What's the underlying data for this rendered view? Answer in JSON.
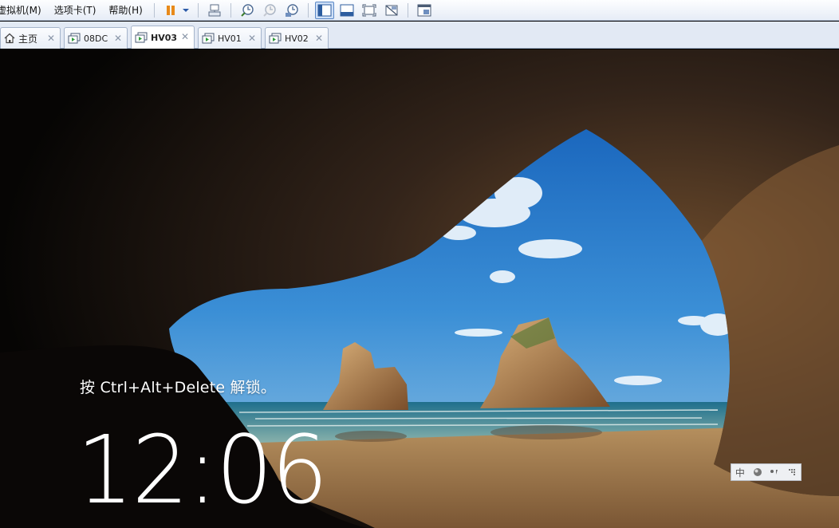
{
  "menubar": {
    "items": [
      {
        "label": "虚拟机(M)"
      },
      {
        "label": "选项卡(T)"
      },
      {
        "label": "帮助(H)"
      }
    ]
  },
  "toolbar": {
    "buttons": [
      {
        "icon": "pause-icon"
      },
      {
        "icon": "dropdown-arrow-icon"
      },
      {
        "icon": "send-ctrl-alt-del-icon"
      },
      {
        "icon": "snapshot-take-icon"
      },
      {
        "icon": "snapshot-revert-icon"
      },
      {
        "icon": "snapshot-manager-icon"
      },
      {
        "icon": "show-library-icon",
        "active": true
      },
      {
        "icon": "thumbnail-bar-icon"
      },
      {
        "icon": "full-screen-icon"
      },
      {
        "icon": "unity-icon"
      },
      {
        "icon": "console-view-icon"
      }
    ]
  },
  "tabs": [
    {
      "label": "主页",
      "icon": "home-icon",
      "active": false
    },
    {
      "label": "08DC",
      "icon": "vm-icon",
      "active": false
    },
    {
      "label": "HV03",
      "icon": "vm-icon",
      "active": true
    },
    {
      "label": "HV01",
      "icon": "vm-icon",
      "active": false
    },
    {
      "label": "HV02",
      "icon": "vm-icon",
      "active": false
    }
  ],
  "lockscreen": {
    "unlock_hint": "按 Ctrl+Alt+Delete 解锁。",
    "time": "12:06"
  },
  "ime": {
    "mode_label": "中",
    "colors": {
      "bar": "#eef0f3"
    }
  },
  "colors": {
    "accent": "#5b88c6",
    "tabbar_bg": "#e2e9f4",
    "sky": "#2f78c4",
    "sand": "#a47a4d"
  }
}
